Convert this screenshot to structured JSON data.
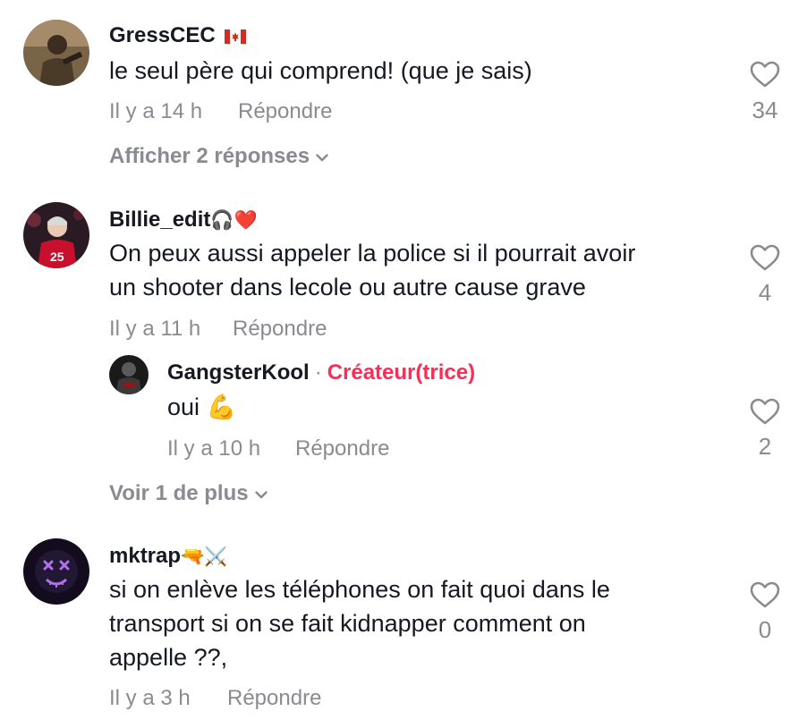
{
  "comments": [
    {
      "username": "GressCEC",
      "flag": "🇨🇦",
      "text": [
        "le seul père qui comprend! (que je sais)"
      ],
      "time": "Il y a 14 h",
      "reply_label": "Répondre",
      "likes": "34",
      "expand_label": "Afficher 2 réponses"
    },
    {
      "username": "Billie_edit",
      "user_emoji": "🎧❤️",
      "text": [
        "On peux aussi appeler la police si il pourrait avoir",
        "un shooter dans lecole ou autre cause grave"
      ],
      "time": "Il y a 11 h",
      "reply_label": "Répondre",
      "likes": "4",
      "reply": {
        "username": "GangsterKool",
        "separator": "·",
        "badge": "Créateur(trice)",
        "text": "oui 💪",
        "time": "Il y a 10 h",
        "reply_label": "Répondre",
        "likes": "2"
      },
      "expand_label": "Voir 1 de plus"
    },
    {
      "username": "mktrap",
      "user_emoji": "🔫⚔️",
      "text": [
        "si on enlève les téléphones on fait quoi dans le",
        "transport si on se fait kidnapper comment on",
        "appelle ??,"
      ],
      "time": "Il y a 3 h",
      "reply_label": "Répondre",
      "likes": "0"
    }
  ],
  "icons": {
    "like": "heart-outline-icon",
    "expand": "chevron-down-icon"
  },
  "colors": {
    "primary_text": "#161823",
    "secondary_text": "#8a8b91",
    "creator_badge": "#fe2c55"
  }
}
